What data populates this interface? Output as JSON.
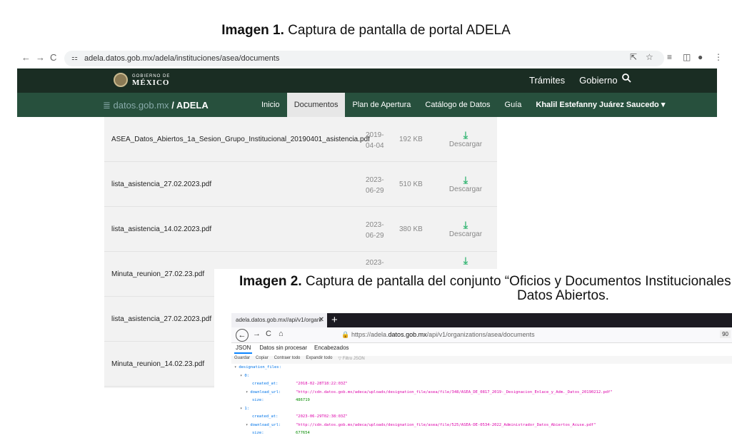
{
  "caption1": {
    "bold": "Imagen 1.",
    "text": " Captura de pantalla de portal ADELA"
  },
  "browser1": {
    "url": "adela.datos.gob.mx/adela/instituciones/asea/documents",
    "nav_back": "←",
    "nav_forward": "→",
    "nav_reload": "C",
    "tune": "⚏",
    "icons": [
      "⇱",
      "☆",
      "≡",
      "◫",
      "●",
      "⋮"
    ]
  },
  "gob_header": {
    "logo_small": "GOBIERNO DE",
    "logo_big": "MÉXICO",
    "nav": [
      "Trámites",
      "Gobierno"
    ]
  },
  "adela_nav": {
    "brand_gray": "≣ datos.gob.mx",
    "brand_bold": "/ ADELA",
    "items": [
      "Inicio",
      "Documentos",
      "Plan de Apertura",
      "Catálogo de Datos",
      "Guía"
    ],
    "user": "Khalil Estefanny Juárez Saucedo ▾"
  },
  "documents": [
    {
      "name": "ASEA_Datos_Abiertos_1a_Sesion_Grupo_Institucional_20190401_asistencia.pdf",
      "date_y": "2019-",
      "date_md": "04-04",
      "size": "192 KB",
      "action": "Descargar"
    },
    {
      "name": "lista_asistencia_27.02.2023.pdf",
      "date_y": "2023-",
      "date_md": "06-29",
      "size": "510 KB",
      "action": "Descargar"
    },
    {
      "name": "lista_asistencia_14.02.2023.pdf",
      "date_y": "2023-",
      "date_md": "06-29",
      "size": "380 KB",
      "action": "Descargar"
    },
    {
      "name": "Minuta_reunion_27.02.23.pdf",
      "date_y": "2023-",
      "date_md": "",
      "size": "",
      "action": ""
    },
    {
      "name": "lista_asistencia_27.02.2023.pdf",
      "date_y": "",
      "date_md": "",
      "size": "",
      "action": ""
    },
    {
      "name": "Minuta_reunion_14.02.23.pdf",
      "date_y": "",
      "date_md": "",
      "size": "",
      "action": ""
    }
  ],
  "caption2": {
    "bold": "Imagen 2.",
    "line1": " Captura de pantalla del conjunto “Oficios y Documentos Institucionales",
    "line2": "Datos Abiertos."
  },
  "browser2": {
    "tab_title": "adela.datos.gob.mx//api/v1/organi",
    "tab_close": "✕",
    "new_tab": "+",
    "url_pre": "https://adela.",
    "url_domain": "datos.gob.mx",
    "url_post": "/api/v1/organizations/asea/documents",
    "zoom": "90",
    "back": "←",
    "forward": "→",
    "reload": "C",
    "home": "⌂",
    "lock": "🔒"
  },
  "viewer_tabs": [
    "JSON",
    "Datos sin procesar",
    "Encabezados"
  ],
  "viewer_tools": [
    "Guardar",
    "Copiar",
    "Contraer todo",
    "Expandir todo"
  ],
  "viewer_filter": "▽ Filtro JSON",
  "json": {
    "root_key": "designation_files:",
    "items": [
      {
        "index": "0:",
        "created_key": "created_at:",
        "created_val": "\"2018-02-28T18:22:03Z\"",
        "url_key": "download_url:",
        "url_val": "\"http://cdn.datos.gob.mx/adeca/uploads/designation_file/asea/file/348/ASEA_DE_0817_2019-_Designacion_Enlace_y_Adm._Datos_20190212.pdf\"",
        "size_key": "size:",
        "size_val": "486719"
      },
      {
        "index": "1:",
        "created_key": "created_at:",
        "created_val": "\"2023-06-29T02:38:03Z\"",
        "url_key": "download_url:",
        "url_val": "\"http://cdn.datos.gob.mx/adeca/uploads/designation_file/asea/file/525/ASEA-DE-0534-2022_Administrador_Datos_Abiertos_Acuse.pdf\"",
        "size_key": "size:",
        "size_val": "677654"
      }
    ]
  }
}
